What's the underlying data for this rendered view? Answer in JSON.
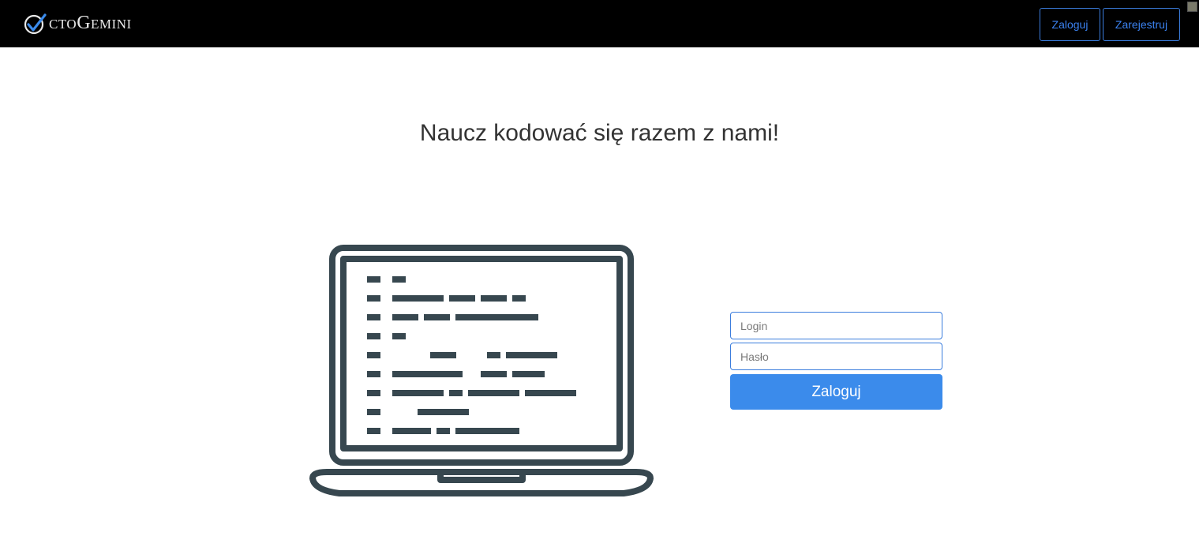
{
  "brand": {
    "logo_text_first": "CTO",
    "logo_text_second": "G",
    "logo_text_third": "EMINI",
    "logo_icon": "checkmark-circle-icon"
  },
  "nav": {
    "login_label": "Zaloguj",
    "register_label": "Zarejestruj"
  },
  "hero": {
    "headline": "Naucz kodować się razem z nami!",
    "illustration_icon": "laptop-code-icon"
  },
  "login_form": {
    "login_placeholder": "Login",
    "password_placeholder": "Hasło",
    "submit_label": "Zaloguj"
  },
  "colors": {
    "navbar_bg": "#000000",
    "accent": "#3b8beb",
    "illustration": "#37474f"
  }
}
